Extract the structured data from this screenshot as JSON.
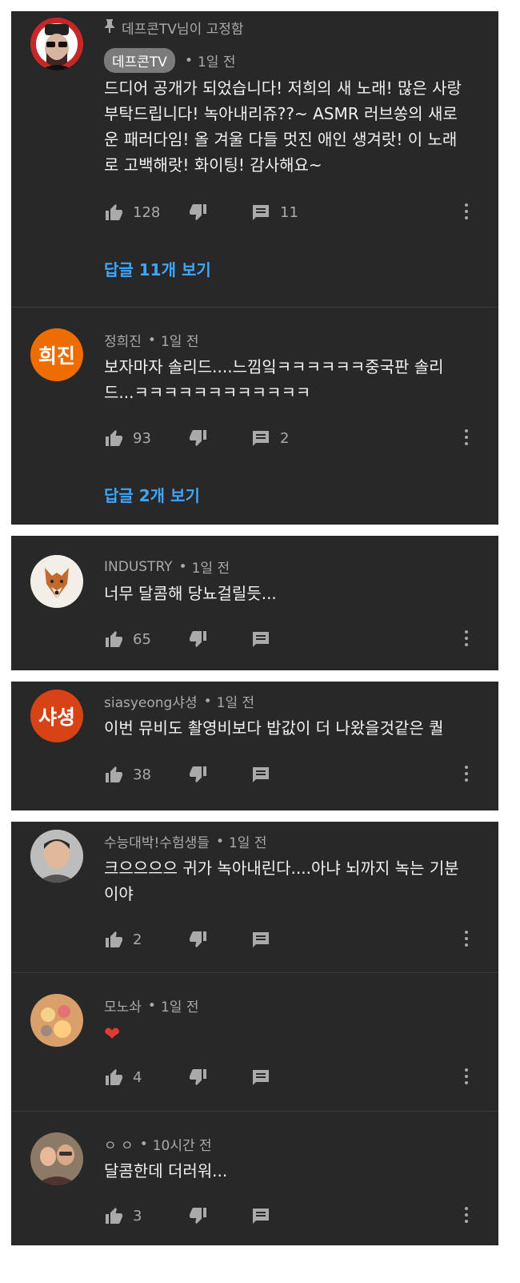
{
  "pinned_label": "데프콘TV님이 고정함",
  "c1": {
    "author": "데프콘TV",
    "time": "1일 전",
    "lines": [
      "드디어 공개가 되었습니다! 저희의 새 노래! 많은 사랑",
      "부탁드립니다! 녹아내리쥬??~ ASMR 러브쏭의 새로",
      "운 패러다임!  올 겨울 다들 멋진 애인 생겨랏! 이 노래",
      "로 고백해랏! 화이팅! 감사해요~"
    ],
    "likes": "128",
    "reply_count": "11",
    "view_replies": "답글 11개 보기"
  },
  "c2": {
    "author": "정희진",
    "avatar_text": "희진",
    "avatar_color": "#ef6c00",
    "time": "1일 전",
    "lines": [
      "보자마자 솔리드....느낌잌ㅋㅋㅋㅋㅋㅋ중국판 솔리",
      "드...ㅋㅋㅋㅋㅋㅋㅋㅋㅋㅋㅋㅋ"
    ],
    "likes": "93",
    "reply_count": "2",
    "view_replies": "답글 2개 보기"
  },
  "c3": {
    "author": "INDUSTRY",
    "time": "1일 전",
    "text": "너무 달콤해 당뇨걸릴듯...",
    "likes": "65"
  },
  "c4": {
    "author": "siasyeong샤셩",
    "avatar_text": "샤셩",
    "avatar_color": "#d84315",
    "time": "1일 전",
    "text": "이번 뮤비도 촬영비보다 밥값이 더 나왔을것같은 퀄",
    "likes": "38"
  },
  "c5": {
    "author": "수능대박!수험생들",
    "time": "1일 전",
    "lines": [
      "크으으으으 귀가 녹아내린다....아냐 뇌까지 녹는 기분",
      "이야"
    ],
    "likes": "2"
  },
  "c6": {
    "author": "모노솨",
    "time": "1일 전",
    "text": "❤",
    "likes": "4"
  },
  "c7": {
    "author": "ㅇ ㅇ",
    "time": "10시간 전",
    "text": "달콤한데 더러워...",
    "likes": "3"
  },
  "separator": "•",
  "colors": {
    "panel": "#282828",
    "link": "#3ea6ff",
    "heart": "#e53935"
  }
}
